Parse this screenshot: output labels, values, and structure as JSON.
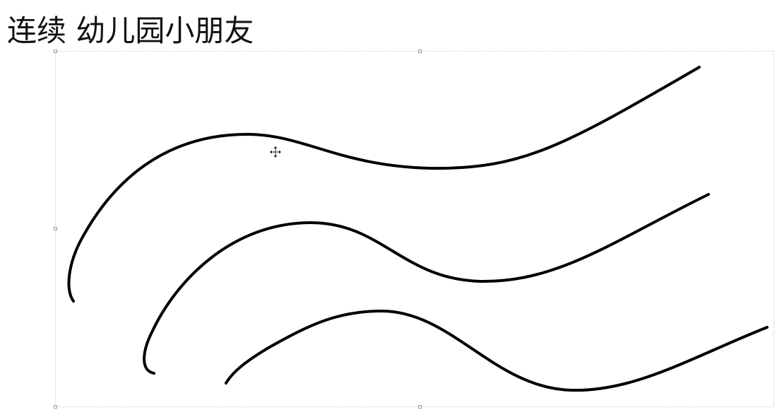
{
  "slide": {
    "title": "连续 幼儿园小朋友"
  },
  "drawing": {
    "stroke_color": "#000000",
    "strokes": [
      "curve-top",
      "curve-middle",
      "curve-bottom"
    ]
  },
  "cursor": {
    "icon": "move-cursor-icon"
  }
}
